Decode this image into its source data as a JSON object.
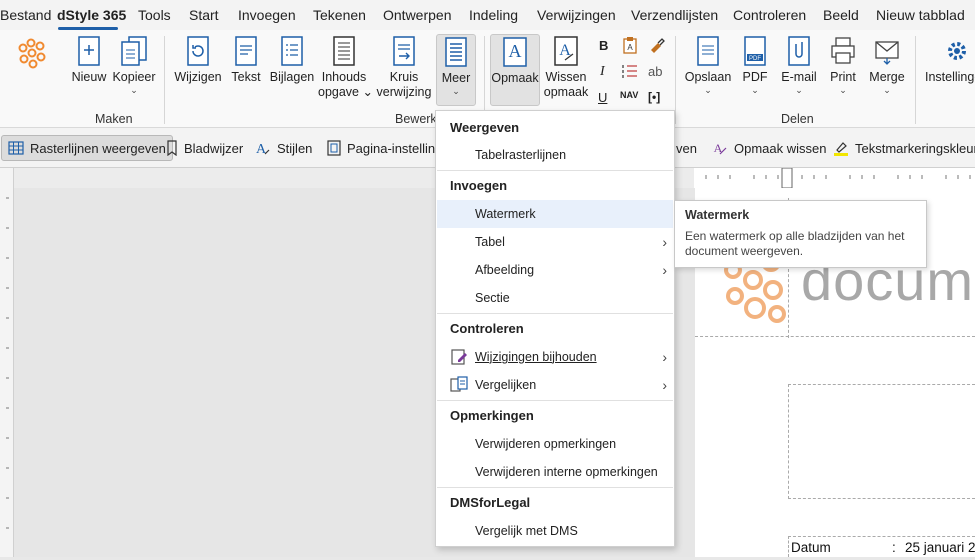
{
  "menubar": {
    "tabs": [
      "Bestand",
      "dStyle 365",
      "Tools",
      "Start",
      "Invoegen",
      "Tekenen",
      "Ontwerpen",
      "Indeling",
      "Verwijzingen",
      "Verzendlijsten",
      "Controleren",
      "Beeld",
      "Nieuw tabblad"
    ],
    "active_tab": "dStyle 365"
  },
  "ribbon": {
    "maken": {
      "label": "Maken",
      "nieuw": "Nieuw",
      "kopieer": "Kopieer"
    },
    "bewerken": {
      "label": "Bewerken",
      "wijzigen": "Wijzigen",
      "tekst": "Tekst",
      "bijlagen": "Bijlagen",
      "inhoudsopgave_1": "Inhouds",
      "inhoudsopgave_2": "opgave",
      "kruisverwijzing_1": "Kruis",
      "kruisverwijzing_2": "verwijzing",
      "meer": "Meer"
    },
    "opmaak": {
      "opmaak": "Opmaak",
      "wissen_1": "Wissen",
      "wissen_2": "opmaak",
      "bold": "B",
      "italic": "I",
      "underline": "U",
      "nav": "NAV",
      "bracket": "[•]",
      "ab": "ab"
    },
    "delen": {
      "label": "Delen",
      "opslaan": "Opslaan",
      "pdf": "PDF",
      "email": "E-mail",
      "print": "Print",
      "merge": "Merge"
    },
    "instellingen": "Instellingen"
  },
  "toolbar2": {
    "rasterlijnen": "Rasterlijnen weergeven",
    "bladwijzer": "Bladwijzer",
    "stijlen": "Stijlen",
    "paginainstelling": "Pagina-instelling",
    "weergeven_tail": "ven",
    "opmaak_wissen": "Opmaak wissen",
    "tekstmarkeringskleur": "Tekstmarkeringskleur"
  },
  "dropdown": {
    "sections": [
      {
        "header": "Weergeven",
        "items": [
          {
            "label": "Tabelrasterlijnen"
          }
        ]
      },
      {
        "header": "Invoegen",
        "items": [
          {
            "label": "Watermerk"
          },
          {
            "label": "Tabel"
          },
          {
            "label": "Afbeelding"
          },
          {
            "label": "Sectie"
          }
        ]
      },
      {
        "header": "Controleren",
        "items": [
          {
            "label": "Wijzigingen bijhouden"
          },
          {
            "label": "Vergelijken"
          }
        ]
      },
      {
        "header": "Opmerkingen",
        "items": [
          {
            "label": "Verwijderen opmerkingen"
          },
          {
            "label": "Verwijderen interne opmerkingen"
          }
        ]
      },
      {
        "header": "DMSforLegal",
        "items": [
          {
            "label": "Vergelijk met DMS"
          }
        ]
      }
    ]
  },
  "tooltip": {
    "title": "Watermerk",
    "description": "Een watermerk op alle bladzijden van het document weergeven."
  },
  "document": {
    "logo_text": "docum",
    "datum_label": "Datum",
    "datum_colon": ":",
    "datum_value": "25 januari 2"
  },
  "colors": {
    "accent": "#1e5fa8",
    "highlight": "#e8f0fb",
    "logo_orange": "#f0a060"
  }
}
